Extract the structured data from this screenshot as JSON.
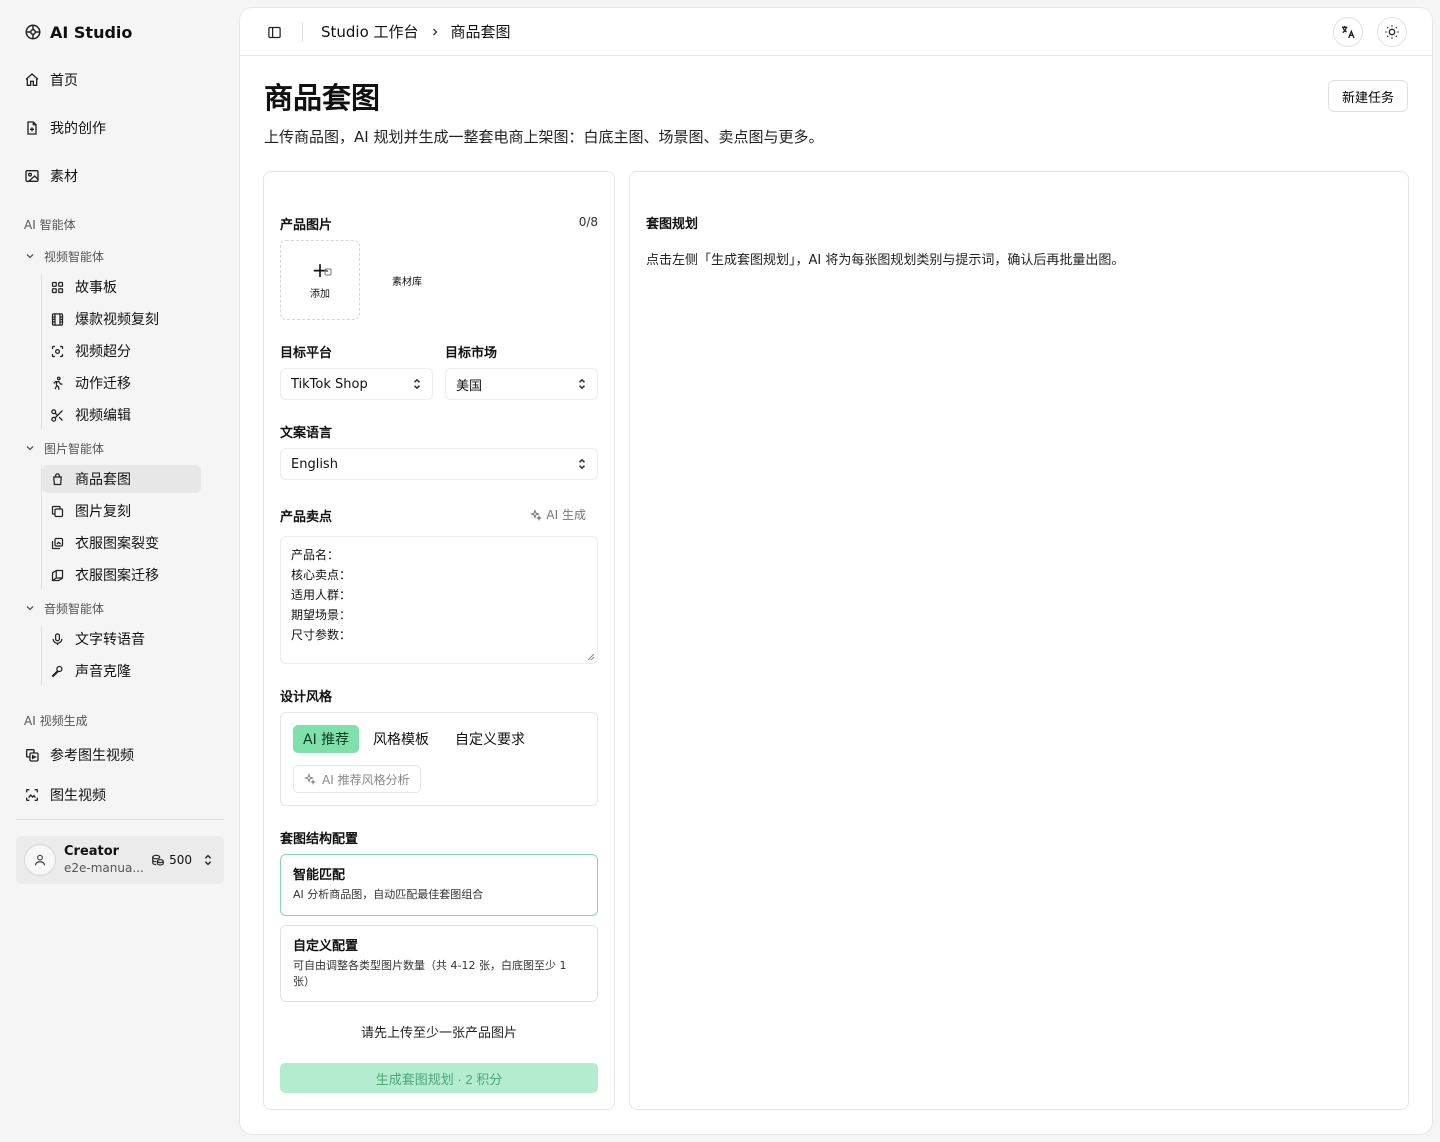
{
  "app": {
    "title": "AI Studio"
  },
  "sidebar": {
    "top_items": [
      {
        "label": "首页",
        "icon": "home-icon"
      },
      {
        "label": "我的创作",
        "icon": "file-icon"
      },
      {
        "label": "素材",
        "icon": "image-icon"
      }
    ],
    "section_ai_agents": "AI 智能体",
    "groups": [
      {
        "label": "视频智能体",
        "items": [
          {
            "label": "故事板",
            "icon": "grid-icon"
          },
          {
            "label": "爆款视频复刻",
            "icon": "film-icon"
          },
          {
            "label": "视频超分",
            "icon": "scan-icon"
          },
          {
            "label": "动作迁移",
            "icon": "running-icon"
          },
          {
            "label": "视频编辑",
            "icon": "scissors-icon"
          }
        ]
      },
      {
        "label": "图片智能体",
        "items": [
          {
            "label": "商品套图",
            "icon": "shopping-bag-icon"
          },
          {
            "label": "图片复刻",
            "icon": "copy-icon"
          },
          {
            "label": "衣服图案裂变",
            "icon": "pattern-icon"
          },
          {
            "label": "衣服图案迁移",
            "icon": "transfer-icon"
          }
        ]
      },
      {
        "label": "音频智能体",
        "items": [
          {
            "label": "文字转语音",
            "icon": "microphone-icon"
          },
          {
            "label": "声音克隆",
            "icon": "mic-stand-icon"
          }
        ]
      }
    ],
    "section_ai_video": "AI 视频生成",
    "bottom_items": [
      {
        "label": "参考图生视频",
        "icon": "reference-video-icon"
      },
      {
        "label": "图生视频",
        "icon": "image-to-video-icon"
      }
    ],
    "user": {
      "name": "Creator",
      "email": "e2e-manua...",
      "credits": "500"
    }
  },
  "header": {
    "breadcrumb_root": "Studio 工作台",
    "breadcrumb_current": "商品套图"
  },
  "page": {
    "title": "商品套图",
    "description": "上传商品图，AI 规划并生成一整套电商上架图：白底主图、场景图、卖点图与更多。",
    "new_task": "新建任务"
  },
  "form": {
    "product_images_label": "产品图片",
    "product_images_count": "0/8",
    "add_label": "添加",
    "library_label": "素材库",
    "platform_label": "目标平台",
    "platform_value": "TikTok Shop",
    "market_label": "目标市场",
    "market_value": "美国",
    "language_label": "文案语言",
    "language_value": "English",
    "selling_points_label": "产品卖点",
    "ai_generate": "AI 生成",
    "selling_points_lines": [
      "产品名：",
      "核心卖点：",
      "适用人群：",
      "期望场景：",
      "尺寸参数："
    ],
    "design_style_label": "设计风格",
    "style_tabs": [
      "AI 推荐",
      "风格模板",
      "自定义要求"
    ],
    "style_analysis": "AI 推荐风格分析",
    "structure_label": "套图结构配置",
    "smart_title": "智能匹配",
    "smart_desc": "AI 分析商品图，自动匹配最佳套图组合",
    "custom_title": "自定义配置",
    "custom_desc": "可自由调整各类型图片数量（共 4-12 张，白底图至少 1 张）",
    "hint": "请先上传至少一张产品图片",
    "generate_button": "生成套图规划 · 2 积分"
  },
  "plan": {
    "title": "套图规划",
    "description": "点击左侧「生成套图规划」，AI 将为每张图规划类别与提示词，确认后再批量出图。"
  },
  "colors": {
    "accent": "#7fe0ab",
    "accent_border": "#7fd9aa",
    "disabled_button": "#b4ecd0"
  }
}
